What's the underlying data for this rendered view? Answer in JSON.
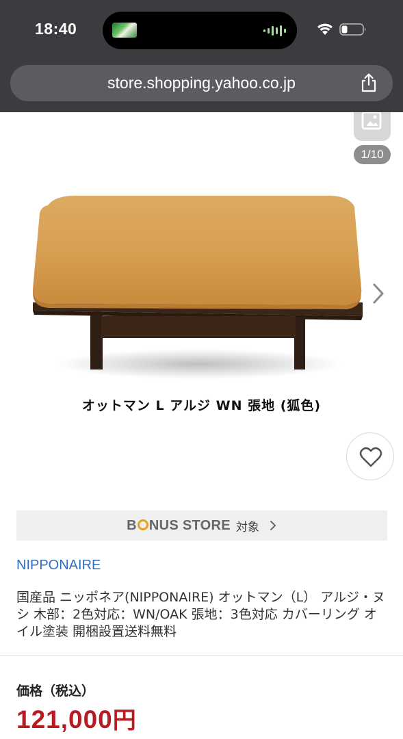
{
  "status_bar": {
    "time": "18:40",
    "icons": [
      "now-playing-thumbnail",
      "audio-waveform-icon",
      "wifi-icon",
      "battery-icon"
    ]
  },
  "browser": {
    "url": "store.shopping.yahoo.co.jp",
    "share_icon": "share-icon"
  },
  "gallery": {
    "counter": "1/10",
    "caption": "オットマン L アルジ WN 張地 (狐色)",
    "icons": [
      "gallery-icon",
      "chevron-right-icon",
      "heart-icon"
    ]
  },
  "bonus_store": {
    "logo_text_pre": "B",
    "logo_text_post": "NUS STORE",
    "label": "対象",
    "icon": "chevron-right-icon",
    "accent_color": "#e8a11c"
  },
  "product": {
    "store_name": "NIPPONAIRE",
    "title": "国産品 ニッポネア(NIPPONAIRE) オットマン（L） アルジ・ヌシ 木部：2色対応：WN/OAK 張地：3色対応 カバーリング オイル塗装 開梱設置送料無料"
  },
  "price": {
    "label": "価格（税込）",
    "amount": "121,000",
    "unit": "円",
    "color": "#b81c22"
  },
  "colors": {
    "topbar": "#3b3c3f",
    "link": "#2d6ec2"
  }
}
